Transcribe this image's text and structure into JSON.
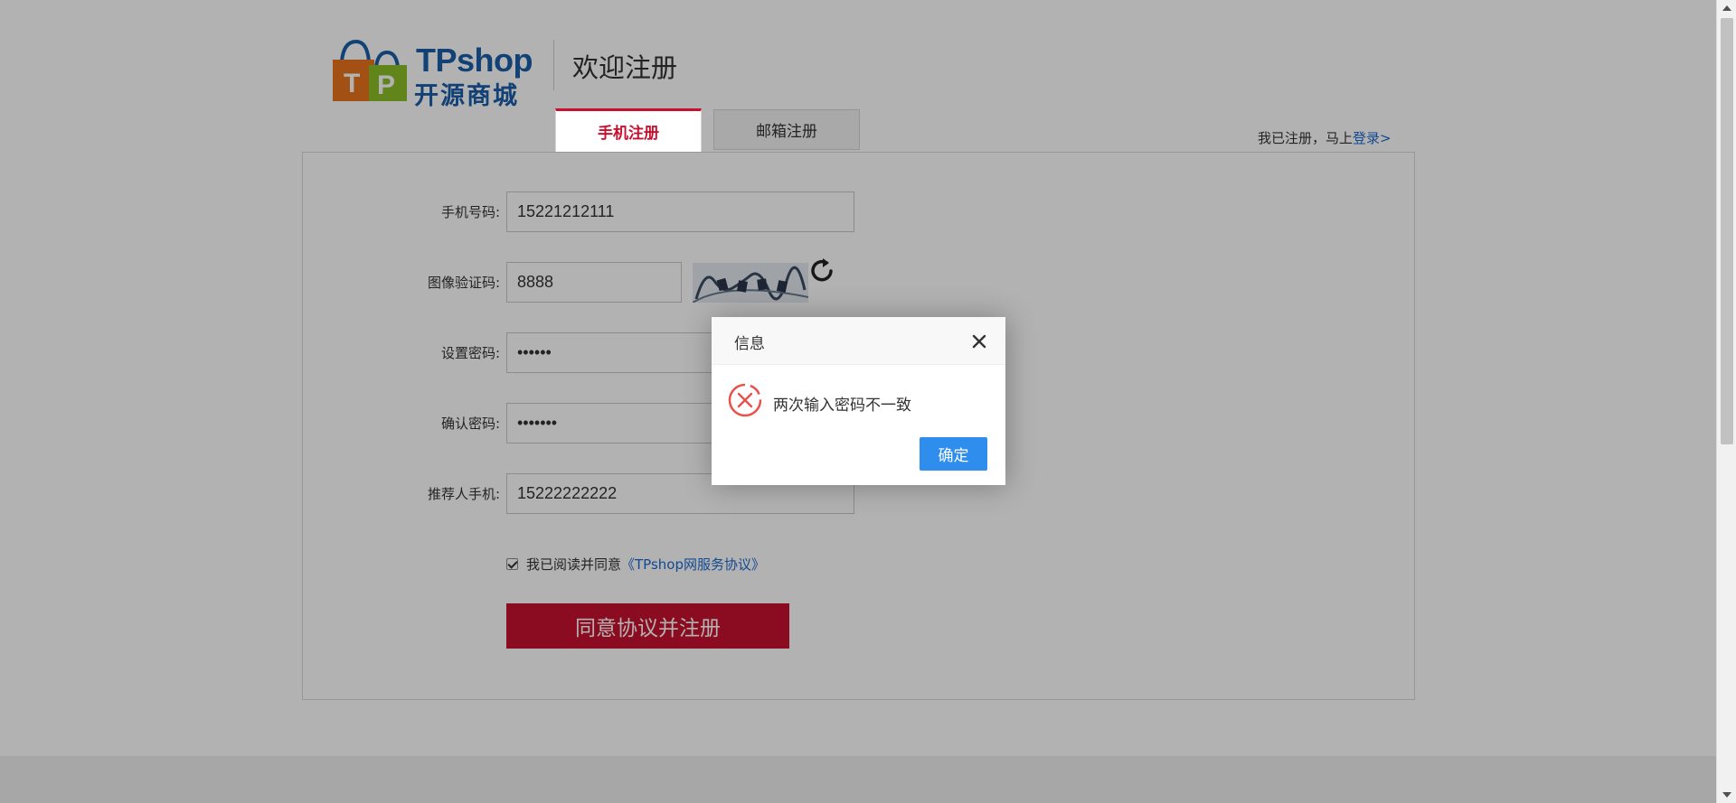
{
  "header": {
    "logo_en": "TPshop",
    "logo_cn": "开源商城",
    "welcome": "欢迎注册"
  },
  "tabs": [
    {
      "label": "手机注册",
      "active": true
    },
    {
      "label": "邮箱注册",
      "active": false
    }
  ],
  "login_hint": {
    "prefix": "我已注册，马上",
    "link": "登录>"
  },
  "form": {
    "phone": {
      "label": "手机号码:",
      "value": "15221212111"
    },
    "captcha": {
      "label": "图像验证码:",
      "value": "8888"
    },
    "password": {
      "label": "设置密码:",
      "value": "••••••"
    },
    "confirm_password": {
      "label": "确认密码:",
      "value": "•••••••"
    },
    "referrer": {
      "label": "推荐人手机:",
      "value": "15222222222"
    },
    "agree": {
      "checked": true,
      "text": "我已阅读并同意",
      "link": "《TPshop网服务协议》"
    },
    "submit_label": "同意协议并注册"
  },
  "dialog": {
    "title": "信息",
    "message": "两次输入密码不一致",
    "ok_label": "确定"
  },
  "colors": {
    "brand_red": "#c8102e",
    "link_blue": "#1b6ad0",
    "dialog_button": "#2e8ded",
    "error_icon": "#e8524a"
  },
  "icons": {
    "refresh": "refresh-icon",
    "close": "close-icon",
    "error": "error-circle-icon"
  }
}
